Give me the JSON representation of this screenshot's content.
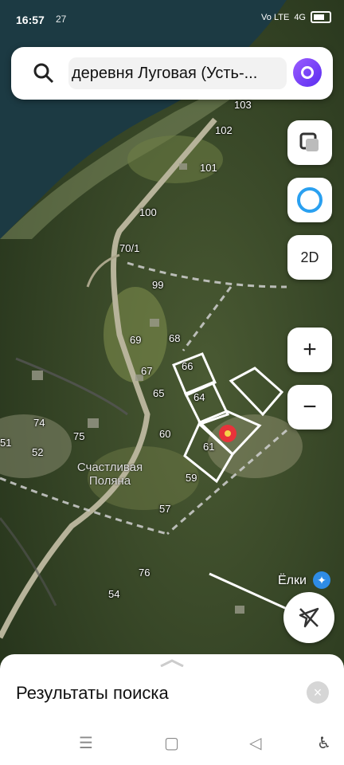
{
  "status_bar": {
    "time": "16:57",
    "temperature": "27",
    "network": "Vo LTE",
    "signal": "4G"
  },
  "search": {
    "query": "деревня Луговая (Усть-..."
  },
  "controls": {
    "view_mode": "2D",
    "zoom_in": "+",
    "zoom_out": "−"
  },
  "map": {
    "place_name": "Ёлки",
    "village_name": "Счастливая Поляна",
    "house_numbers": [
      "103",
      "102",
      "101",
      "100",
      "70/1",
      "99",
      "69",
      "68",
      "66",
      "67",
      "64",
      "65",
      "60",
      "61",
      "59",
      "57",
      "76",
      "54",
      "74",
      "75",
      "52",
      "51"
    ]
  },
  "sheet": {
    "title": "Результаты поиска",
    "close": "×"
  },
  "colors": {
    "accent": "#5a2df0",
    "marker": "#e8333a",
    "plot_outline": "#ffffff"
  }
}
